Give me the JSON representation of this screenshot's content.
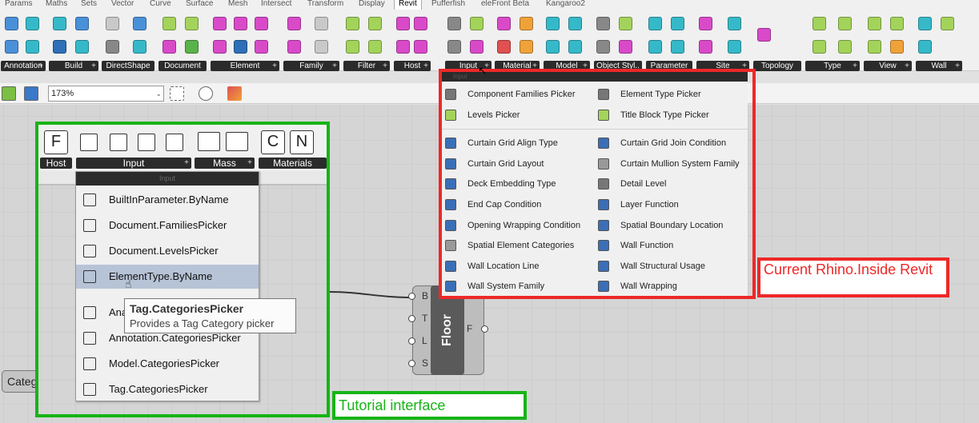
{
  "menu_tabs": [
    "Params",
    "Maths",
    "Sets",
    "Vector",
    "Curve",
    "Surface",
    "Mesh",
    "Intersect",
    "Transform",
    "Display",
    "Revit",
    "Pufferfish",
    "eleFront Beta",
    "Kangaroo2"
  ],
  "active_tab": "Revit",
  "ribbon_groups": [
    "Annotation",
    "Build",
    "DirectShape",
    "Document",
    "Element",
    "Family",
    "Filter",
    "Host",
    "Input",
    "Material",
    "Model",
    "Object Styl..",
    "Parameter",
    "Site",
    "Topology",
    "Type",
    "View",
    "Wall"
  ],
  "toolbar": {
    "zoom": "173%",
    "zoom_arrow": "⌄"
  },
  "canvas_component_left": "Categ",
  "floor_component": {
    "name": "Floor",
    "inputs": [
      "B",
      "T",
      "L",
      "S"
    ],
    "output": "F"
  },
  "tutorial": {
    "buttons": [
      "F",
      "C",
      "N"
    ],
    "group_labels": [
      "Host",
      "Input",
      "Mass",
      "Materials"
    ],
    "menu_header": "Input",
    "menu_items": [
      "BuiltInParameter.ByName",
      "Document.FamiliesPicker",
      "Document.LevelsPicker",
      "ElementType.ByName",
      "Analytical.CategoriesPicker",
      "Annotation.CategoriesPicker",
      "Model.CategoriesPicker",
      "Tag.CategoriesPicker"
    ],
    "analytical_visible": "Ana",
    "hovered_item": "ElementType.ByName",
    "tooltip_title": "Tag.CategoriesPicker",
    "tooltip_desc": "Provides a Tag Category picker",
    "caption": "Tutorial interface"
  },
  "revit_menu": {
    "header": "Input",
    "top_left": [
      "Component Families Picker",
      "Levels Picker"
    ],
    "top_right": [
      "Element Type Picker",
      "Title Block Type Picker"
    ],
    "left": [
      "Curtain Grid Align Type",
      "Curtain Grid Layout",
      "Deck Embedding Type",
      "End Cap Condition",
      "Opening Wrapping Condition",
      "Spatial Element Categories",
      "Wall Location Line",
      "Wall System Family"
    ],
    "right": [
      "Curtain Grid Join Condition",
      "Curtain Mullion System Family",
      "Detail Level",
      "Layer Function",
      "Spatial Boundary Location",
      "Wall Function",
      "Wall Structural Usage",
      "Wall Wrapping"
    ],
    "caption": "Current Rhino.Inside Revit"
  },
  "colors": {
    "green": "#17b416",
    "red": "#ee2828",
    "hover": "#b7c3d6"
  }
}
